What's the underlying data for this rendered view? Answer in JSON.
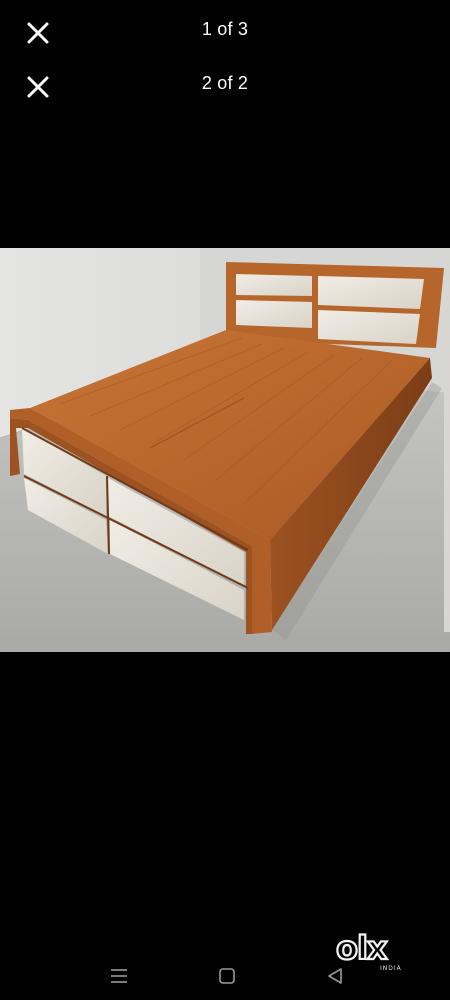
{
  "viewer": {
    "primary_counter": "1 of 3",
    "secondary_counter": "2 of 2",
    "close_icon": "close-icon",
    "image_subject": "storage-bed-photo"
  },
  "watermark": {
    "brand": "olx",
    "tagline": "INDIA"
  },
  "navbar": {
    "menu_icon": "menu-icon",
    "home_icon": "home-square-icon",
    "back_icon": "back-triangle-icon"
  },
  "colors": {
    "background": "#000000",
    "text": "#ffffff",
    "wood": "#b8672e",
    "panel": "#e8e3da"
  }
}
